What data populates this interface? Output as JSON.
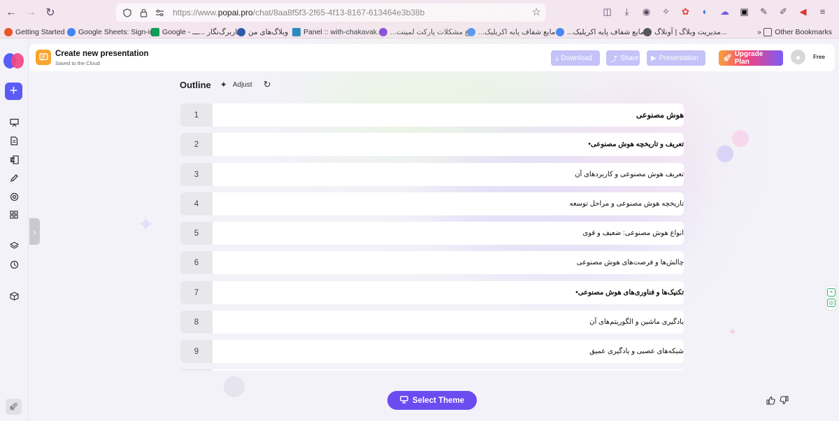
{
  "browser": {
    "url_prefix": "https://www.",
    "url_domain": "popai.pro",
    "url_path": "/chat/8aa8f5f3-2f65-4f13-8167-613464e3b38b",
    "bookmarks": [
      {
        "label": "Getting Started",
        "color": "#e8562a"
      },
      {
        "label": "Google Sheets: Sign-in",
        "color": "#4285f4"
      },
      {
        "label": "Google - کاربرگ‌نگار ...ـــ",
        "color": "#0f9d58"
      },
      {
        "label": "وبلاگ‌های من",
        "color": "#2b5cab"
      },
      {
        "label": "Panel :: with-chakavak...",
        "color": "#2b8abf"
      },
      {
        "label": "...ع مشکلات پارکت لمینت",
        "color": "#7b3ad8"
      },
      {
        "label": "...مایع شفاف پایه اکریلیک",
        "color": "#4285f4"
      },
      {
        "label": "...مایع شفاف پایه اکریلیک",
        "color": "#4285f4"
      },
      {
        "label": "مدیریت وبلاگ | آونلاگ...",
        "color": "#555555"
      }
    ],
    "other_bookmarks": "Other Bookmarks"
  },
  "header": {
    "title": "Create new presentation",
    "subtitle": "Saved to the Cloud",
    "download": "Download",
    "share": "Share",
    "presentation": "Presentation",
    "upgrade": "Upgrade Plan",
    "plan": "Free"
  },
  "outline": {
    "title": "Outline",
    "adjust": "Adjust",
    "items": [
      {
        "num": "1",
        "text": "هوش مصنوعی",
        "level": 1
      },
      {
        "num": "2",
        "text": "تعریف و تاریخچه هوش مصنوعی",
        "level": 2
      },
      {
        "num": "3",
        "text": "تعریف هوش مصنوعی و کاربردهای آن",
        "level": 3
      },
      {
        "num": "4",
        "text": "تاریخچه هوش مصنوعی و مراحل توسعه",
        "level": 3
      },
      {
        "num": "5",
        "text": "انواع هوش مصنوعی: ضعیف و قوی",
        "level": 3
      },
      {
        "num": "6",
        "text": "چالش‌ها و فرصت‌های هوش مصنوعی",
        "level": 3
      },
      {
        "num": "7",
        "text": "تکنیک‌ها و فناوری‌های هوش مصنوعی",
        "level": 2
      },
      {
        "num": "8",
        "text": "یادگیری ماشین و الگوریتم‌های آن",
        "level": 3
      },
      {
        "num": "9",
        "text": "شبکه‌های عصبی و یادگیری عمیق",
        "level": 3
      }
    ]
  },
  "actions": {
    "select_theme": "Select Theme"
  },
  "colors": {
    "accent": "#5b5cf6",
    "select_theme_bg": "#6a4cf0",
    "disabled_btn": "#c4c2f7"
  }
}
